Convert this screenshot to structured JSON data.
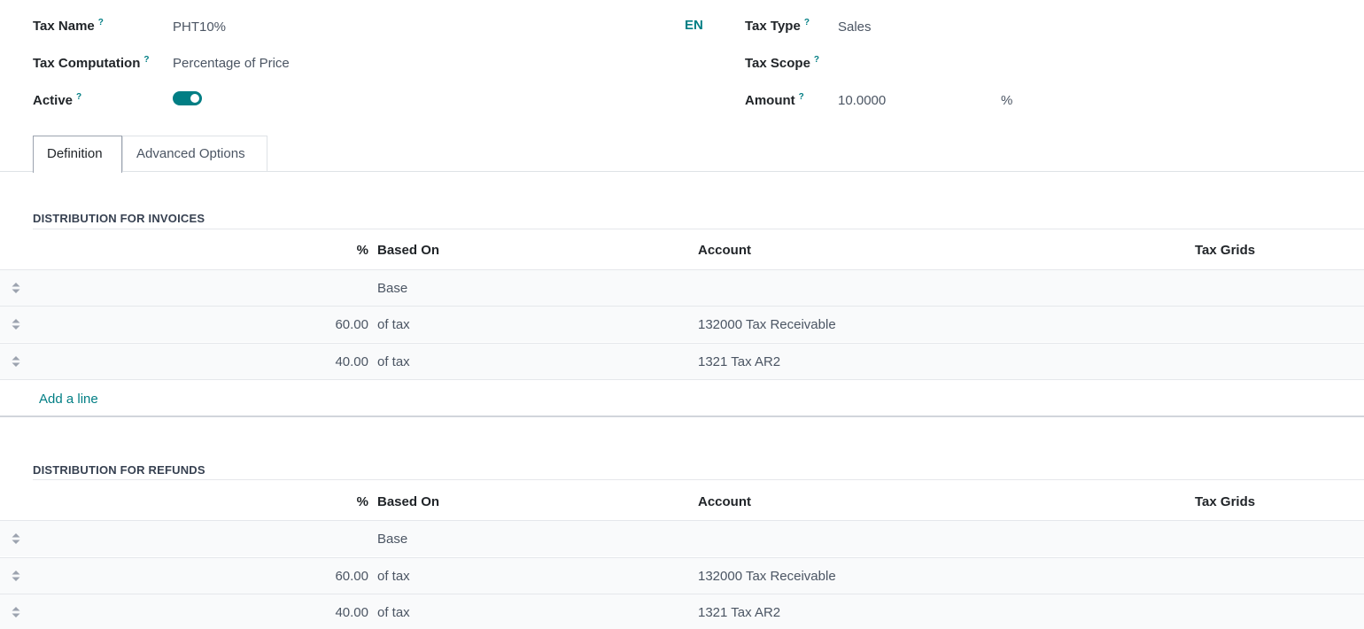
{
  "form": {
    "tax_name_label": "Tax Name",
    "tax_name_value": "PHT10%",
    "tax_computation_label": "Tax Computation",
    "tax_computation_value": "Percentage of Price",
    "active_label": "Active",
    "active_on": true,
    "lang_button": "EN",
    "tax_type_label": "Tax Type",
    "tax_type_value": "Sales",
    "tax_scope_label": "Tax Scope",
    "tax_scope_value": "",
    "amount_label": "Amount",
    "amount_value": "10.0000",
    "amount_unit": "%",
    "help_mark": "?"
  },
  "tabs": [
    {
      "label": "Definition",
      "active": true
    },
    {
      "label": "Advanced Options",
      "active": false
    }
  ],
  "columns": {
    "percent": "%",
    "based_on": "Based On",
    "account": "Account",
    "tax_grids": "Tax Grids"
  },
  "invoices": {
    "title": "DISTRIBUTION FOR INVOICES",
    "rows": [
      {
        "percent": "",
        "based_on": "Base",
        "account": "",
        "tax_grids": ""
      },
      {
        "percent": "60.00",
        "based_on": "of tax",
        "account": "132000 Tax Receivable",
        "tax_grids": ""
      },
      {
        "percent": "40.00",
        "based_on": "of tax",
        "account": "1321 Tax AR2",
        "tax_grids": ""
      }
    ],
    "add_line": "Add a line"
  },
  "refunds": {
    "title": "DISTRIBUTION FOR REFUNDS",
    "rows": [
      {
        "percent": "",
        "based_on": "Base",
        "account": "",
        "tax_grids": ""
      },
      {
        "percent": "60.00",
        "based_on": "of tax",
        "account": "132000 Tax Receivable",
        "tax_grids": ""
      },
      {
        "percent": "40.00",
        "based_on": "of tax",
        "account": "1321 Tax AR2",
        "tax_grids": ""
      }
    ]
  },
  "colors": {
    "accent": "#017e84",
    "row_bg": "#f9fafb",
    "border": "#e5e7eb"
  },
  "icons": {
    "help": "question-mark-icon",
    "drag": "drag-handle-icon"
  }
}
